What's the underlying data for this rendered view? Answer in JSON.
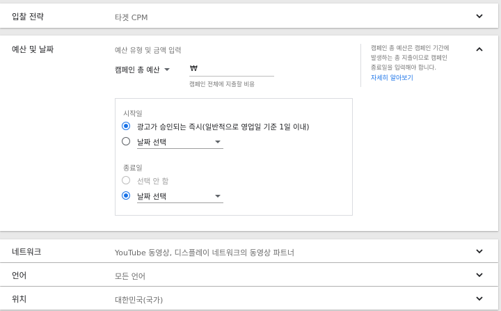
{
  "rows": {
    "bidding": {
      "label": "입찰 전략",
      "value": "타겟 CPM"
    },
    "budget": {
      "label": "예산 및 날짜",
      "hint": "예산 유형 및 금액 입력",
      "budget_type": "캠페인 총 예산",
      "currency": "₩",
      "amount_helper": "캠페인 전체에 지출할 비용",
      "side_help": [
        "캠페인 총 예산은 캠페인 기간에",
        "발생하는 총 지출이므로 캠페인",
        "종료일을 입력해야 합니다."
      ],
      "learn_more": "자세히 알아보기",
      "start": {
        "title": "시작일",
        "option_immediate": "광고가 승인되는 즉시(일반적으로 영업일 기준 1일 이내)",
        "option_pick": "날짜 선택"
      },
      "end": {
        "title": "종료일",
        "option_none": "선택 안 함",
        "option_pick": "날짜 선택"
      }
    },
    "network": {
      "label": "네트워크",
      "value": "YouTube 동영상, 디스플레이 네트워크의 동영상 파트너"
    },
    "language": {
      "label": "언어",
      "value": "모든 언어"
    },
    "location": {
      "label": "위치",
      "value": "대한민국(국가)"
    }
  },
  "colors": {
    "accent": "#1a73e8",
    "link": "#1a73e8"
  },
  "icons": [
    "chevron-down-icon",
    "chevron-up-icon",
    "dropdown-caret-icon"
  ]
}
